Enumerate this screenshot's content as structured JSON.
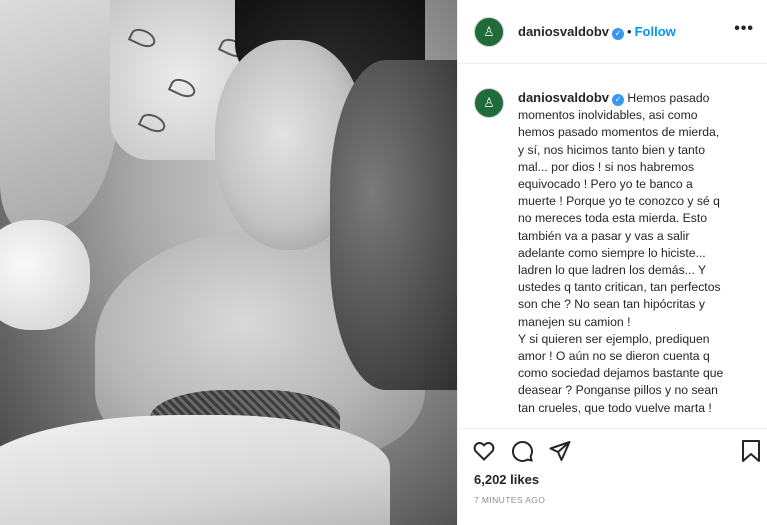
{
  "post": {
    "username": "daniosvaldobv",
    "avatar_glyph": "♙",
    "verified_glyph": "✓",
    "separator": "•",
    "follow_label": "Follow",
    "more_glyph": "•••",
    "caption": "Hemos pasado\nmomentos inolvidables, asi como\nhemos pasado momentos de mierda,\ny sí, nos hicimos tanto bien y tanto\nmal... por dios ! si nos habremos\nequivocado ! Pero yo te banco a\nmuerte ! Porque yo te conozco y sé q\nno mereces toda esta mierda. Esto\ntambién va a pasar y vas a salir\nadelante como siempre lo hiciste...\nladren lo que ladren los demás... Y\nustedes q tanto critican, tan perfectos\nson che ? No sean tan hipócritas y\nmanejen su camion !\nY si quieren ser ejemplo, prediquen\namor ! O aún no se dieron cuenta q\ncomo sociedad dejamos bastante que\ndeasear ? Ponganse pillos y no sean\ntan crueles, que todo vuelve marta !",
    "likes": "6,202 likes",
    "time": "7 MINUTES AGO"
  },
  "icons": {
    "like": "heart-icon",
    "comment": "comment-icon",
    "share": "paper-plane-icon",
    "save": "bookmark-icon",
    "more": "more-options-icon",
    "verified": "verified-badge-icon"
  },
  "colors": {
    "follow": "#0095f6",
    "verified": "#3897f0",
    "avatar_bg": "#1f6b3a",
    "muted": "#8e8e8e"
  }
}
